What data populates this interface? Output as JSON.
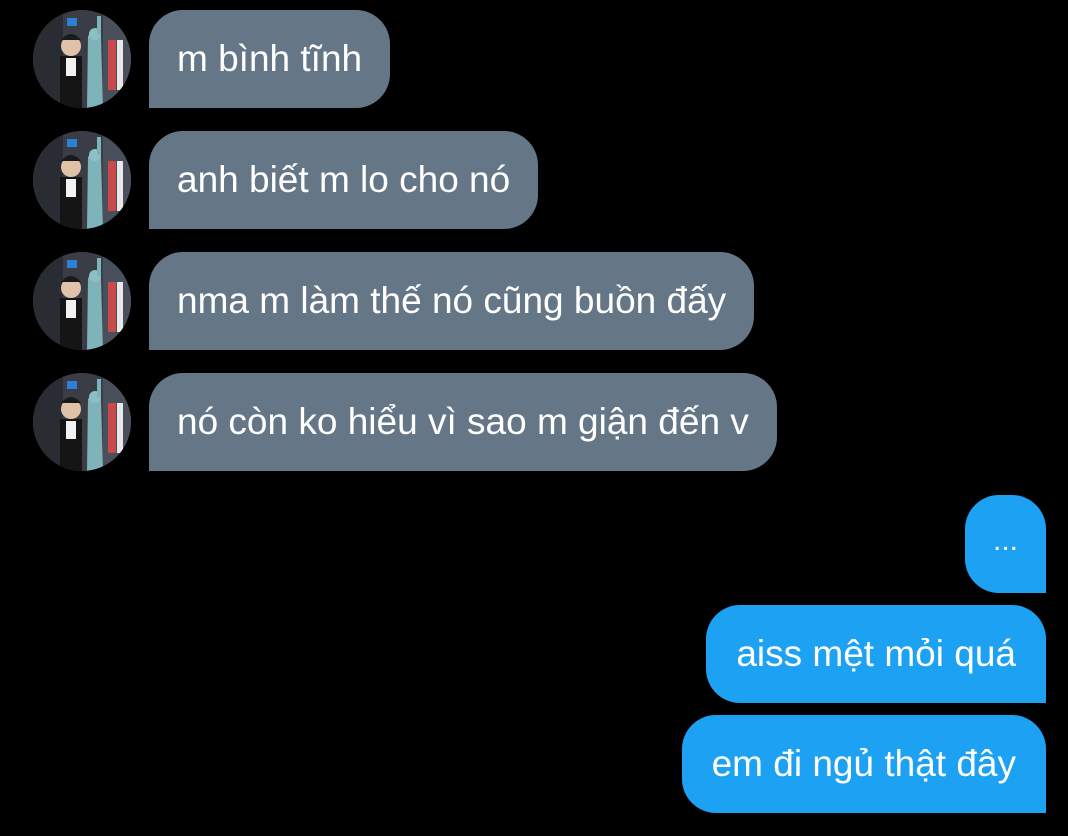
{
  "conversation": {
    "incoming": [
      {
        "text": "m bình tĩnh",
        "avatar_icon": "user-avatar-icon"
      },
      {
        "text": "anh biết m lo cho nó",
        "avatar_icon": "user-avatar-icon"
      },
      {
        "text": "nma m làm thế nó cũng buồn đấy",
        "avatar_icon": "user-avatar-icon"
      },
      {
        "text": "nó còn ko hiểu vì sao m giận đến v",
        "avatar_icon": "user-avatar-icon"
      }
    ],
    "outgoing": [
      {
        "text": "..."
      },
      {
        "text": "aiss mệt mỏi quá"
      },
      {
        "text": "em đi ngủ thật đây"
      }
    ]
  },
  "colors": {
    "background": "#000000",
    "incoming_bubble": "#657786",
    "outgoing_bubble": "#1da1f2",
    "text": "#ffffff"
  }
}
